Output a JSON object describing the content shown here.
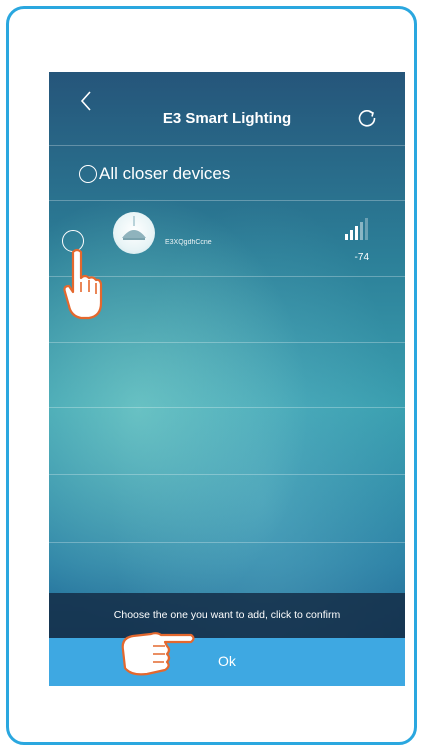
{
  "header": {
    "title": "E3 Smart Lighting",
    "back_icon": "chevron-left-icon",
    "refresh_icon": "refresh-icon"
  },
  "select_all": {
    "label": "All closer devices"
  },
  "devices": [
    {
      "name": "E3XQgdhCcne",
      "rssi": "-74",
      "signal_icon": "signal-strength-icon"
    }
  ],
  "hint": "Choose the one you want to add, click to confirm",
  "footer": {
    "ok_label": "Ok"
  },
  "colors": {
    "frame_border": "#2aa7df",
    "ok_bar": "#3ea8e2",
    "hand_fill": "#ffffff",
    "hand_stroke": "#e4682e"
  }
}
